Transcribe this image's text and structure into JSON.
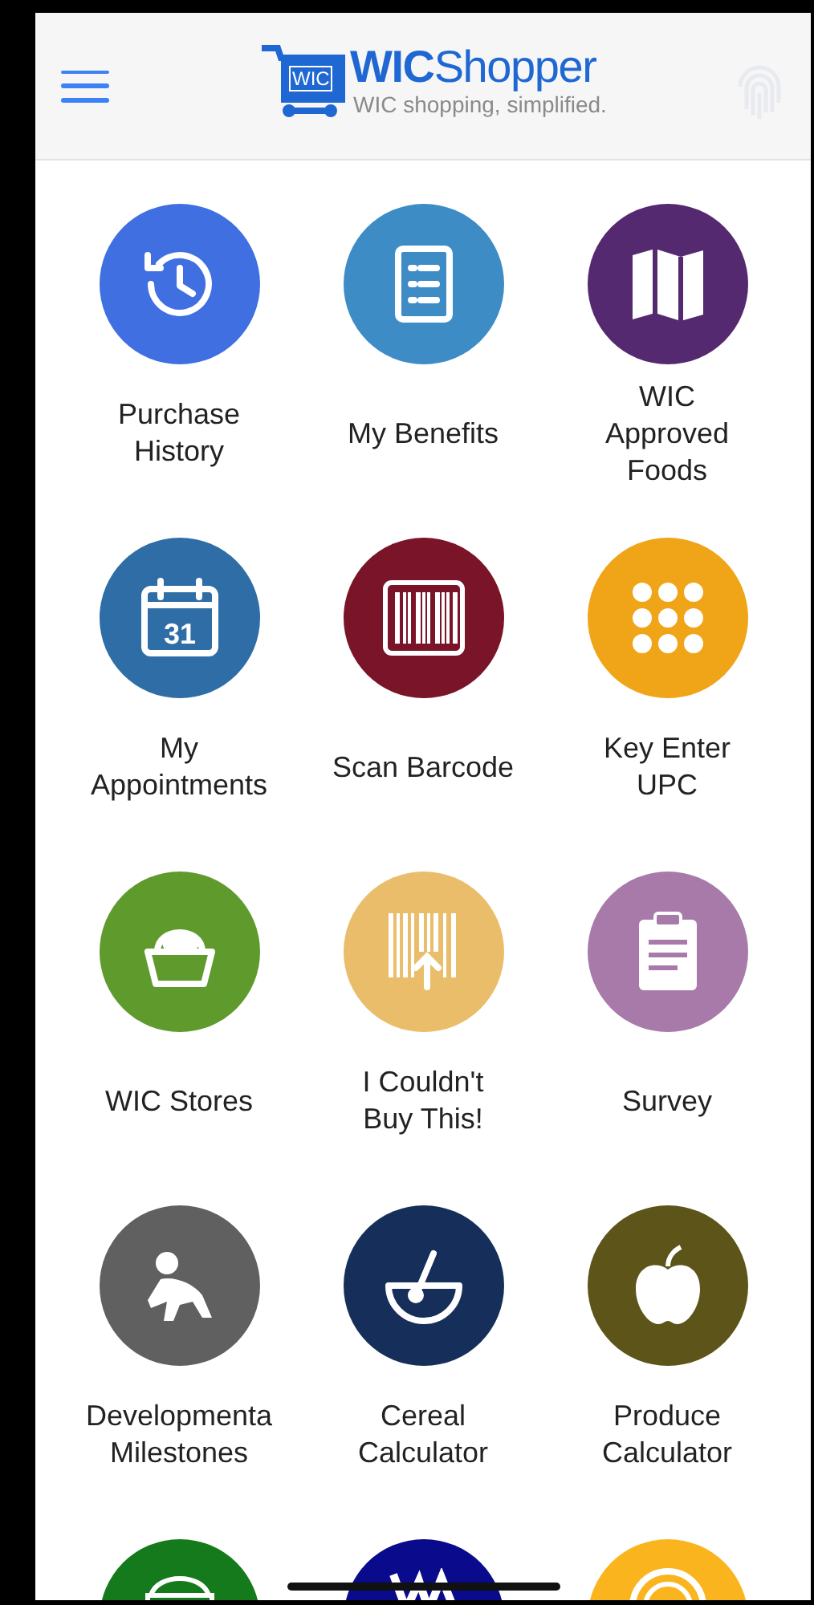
{
  "header": {
    "logo_badge": "WIC",
    "title": "**WIC**Shopper",
    "tagline": "WIC shopping, simplified."
  },
  "tiles": [
    {
      "label": "Purchase\nHistory",
      "kind": "history",
      "color": "#3f6fe0"
    },
    {
      "label": "My Benefits",
      "kind": "list",
      "color": "#3d8cc6"
    },
    {
      "label": "WIC\nApproved\nFoods",
      "kind": "map",
      "color": "#55296f"
    },
    {
      "label": "My\nAppointments",
      "kind": "calendar",
      "color": "#2e6da5",
      "day": "31"
    },
    {
      "label": "Scan Barcode",
      "kind": "barcode",
      "color": "#7a1428"
    },
    {
      "label": "Key Enter\nUPC",
      "kind": "keypad",
      "color": "#f0a518"
    },
    {
      "label": "WIC Stores",
      "kind": "basket",
      "color": "#5f9a2d"
    },
    {
      "label": "I Couldn't\nBuy This!",
      "kind": "upload",
      "color": "#eabd6a"
    },
    {
      "label": "Survey",
      "kind": "clipboard",
      "color": "#a77aa9"
    },
    {
      "label": "Developmenta\nMilestones",
      "kind": "baby",
      "color": "#606060"
    },
    {
      "label": "Cereal\nCalculator",
      "kind": "bowl",
      "color": "#162e5a"
    },
    {
      "label": "Produce\nCalculator",
      "kind": "apple",
      "color": "#5c5418"
    },
    {
      "kind": "grain",
      "color": "#157a1c"
    },
    {
      "kind": "wave",
      "color": "#0a0a8c"
    },
    {
      "kind": "ring",
      "color": "#fab51e"
    }
  ]
}
